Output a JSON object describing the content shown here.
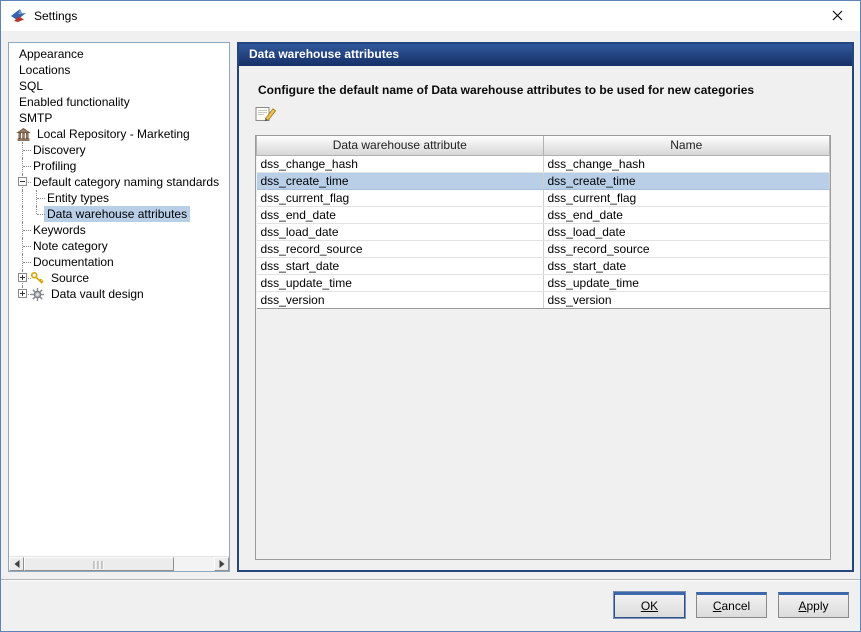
{
  "window": {
    "title": "Settings"
  },
  "sidebar": {
    "items": [
      {
        "label": "Appearance",
        "prefix": []
      },
      {
        "label": "Locations",
        "prefix": []
      },
      {
        "label": "SQL",
        "prefix": []
      },
      {
        "label": "Enabled functionality",
        "prefix": []
      },
      {
        "label": "SMTP",
        "prefix": []
      },
      {
        "label": "Local Repository - Marketing",
        "prefix": [
          "icon-repository"
        ]
      },
      {
        "label": "Discovery",
        "prefix": [
          "t"
        ]
      },
      {
        "label": "Profiling",
        "prefix": [
          "t"
        ]
      },
      {
        "label": "Default category naming standards",
        "prefix": [
          "tm"
        ]
      },
      {
        "label": "Entity types",
        "prefix": [
          "v",
          "t"
        ]
      },
      {
        "label": "Data warehouse attributes",
        "prefix": [
          "v",
          "l"
        ],
        "selected": true
      },
      {
        "label": "Keywords",
        "prefix": [
          "t"
        ]
      },
      {
        "label": "Note category",
        "prefix": [
          "t"
        ]
      },
      {
        "label": "Documentation",
        "prefix": [
          "t"
        ]
      },
      {
        "label": "Source",
        "prefix": [
          "tp",
          "icon-keys"
        ]
      },
      {
        "label": "Data vault design",
        "prefix": [
          "lp",
          "icon-gear"
        ]
      }
    ]
  },
  "panel": {
    "title": "Data warehouse attributes",
    "description": "Configure the default name of Data warehouse attributes to be used for new categories",
    "table": {
      "columns": [
        "Data warehouse attribute",
        "Name"
      ],
      "rows": [
        [
          "dss_change_hash",
          "dss_change_hash"
        ],
        [
          "dss_create_time",
          "dss_create_time"
        ],
        [
          "dss_current_flag",
          "dss_current_flag"
        ],
        [
          "dss_end_date",
          "dss_end_date"
        ],
        [
          "dss_load_date",
          "dss_load_date"
        ],
        [
          "dss_record_source",
          "dss_record_source"
        ],
        [
          "dss_start_date",
          "dss_start_date"
        ],
        [
          "dss_update_time",
          "dss_update_time"
        ],
        [
          "dss_version",
          "dss_version"
        ]
      ],
      "selected_row": 1
    }
  },
  "footer": {
    "buttons": [
      {
        "label": "OK",
        "underline": 2,
        "default": true
      },
      {
        "label": "Cancel",
        "underline": 1
      },
      {
        "label": "Apply",
        "underline": 1
      }
    ]
  },
  "colors": {
    "panel_header": "#152f66",
    "panel_border": "#26457e",
    "selection": "#b9cfe8",
    "button_accent": "#3e68ac"
  }
}
